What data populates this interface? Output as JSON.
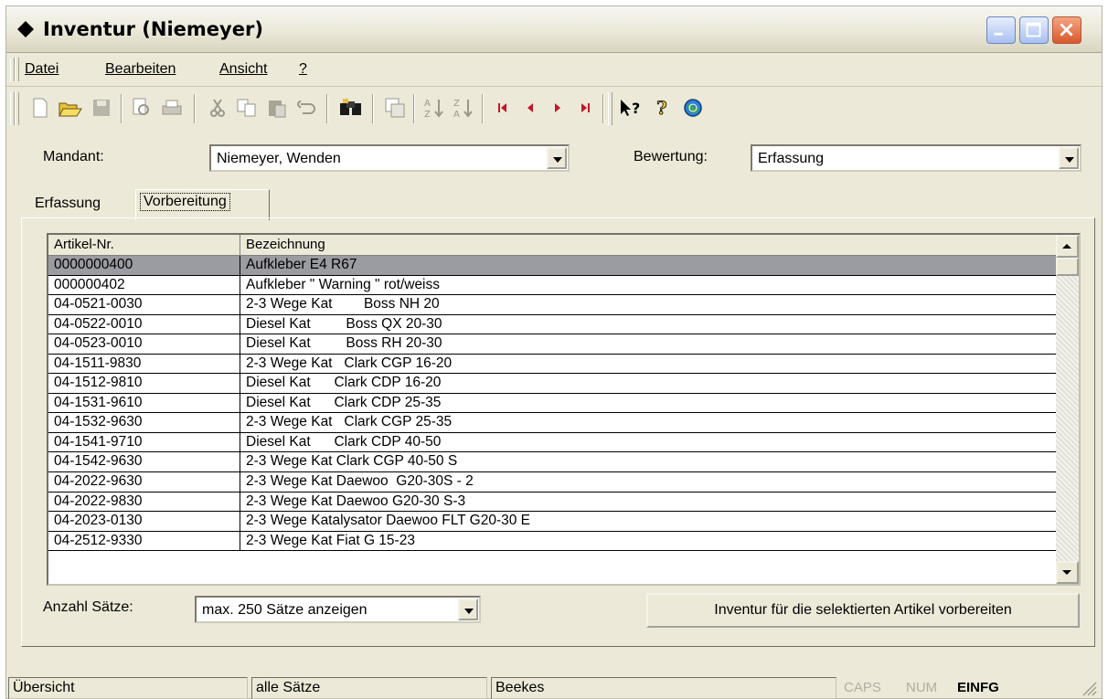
{
  "window": {
    "title": "Inventur (Niemeyer)"
  },
  "menu": [
    {
      "label": "Datei"
    },
    {
      "label": "Bearbeiten"
    },
    {
      "label": "Ansicht"
    },
    {
      "label": "?"
    }
  ],
  "toolbar": {
    "icons": [
      "new-icon",
      "open-icon",
      "save-icon",
      "print-preview-icon",
      "print-icon",
      "cut-icon",
      "copy-icon",
      "paste-icon",
      "undo-icon",
      "find-icon",
      "copy-record-icon",
      "sort-ascending-icon",
      "sort-descending-icon",
      "first-record-icon",
      "previous-record-icon",
      "next-record-icon",
      "last-record-icon",
      "whats-this-icon",
      "help-icon",
      "internet-icon"
    ]
  },
  "form": {
    "mandant_label": "Mandant:",
    "mandant_value": "Niemeyer, Wenden",
    "bewertung_label": "Bewertung:",
    "bewertung_value": "Erfassung"
  },
  "tabs": [
    {
      "label": "Erfassung",
      "active": false
    },
    {
      "label": "Vorbereitung",
      "active": true
    }
  ],
  "table": {
    "columns": [
      "Artikel-Nr.",
      "Bezeichnung"
    ],
    "rows": [
      [
        "0000000400",
        "Aufkleber E4 R67"
      ],
      [
        "000000402",
        "Aufkleber \" Warning \" rot/weiss"
      ],
      [
        "04-0521-0030",
        "2-3 Wege Kat        Boss NH 20"
      ],
      [
        "04-0522-0010",
        "Diesel Kat         Boss QX 20-30"
      ],
      [
        "04-0523-0010",
        "Diesel Kat         Boss RH 20-30"
      ],
      [
        "04-1511-9830",
        "2-3 Wege Kat   Clark CGP 16-20"
      ],
      [
        "04-1512-9810",
        "Diesel Kat      Clark CDP 16-20"
      ],
      [
        "04-1531-9610",
        "Diesel Kat      Clark CDP 25-35"
      ],
      [
        "04-1532-9630",
        "2-3 Wege Kat   Clark CGP 25-35"
      ],
      [
        "04-1541-9710",
        "Diesel Kat      Clark CDP 40-50"
      ],
      [
        "04-1542-9630",
        "2-3 Wege Kat Clark CGP 40-50 S"
      ],
      [
        "04-2022-9630",
        "2-3 Wege Kat Daewoo  G20-30S - 2"
      ],
      [
        "04-2022-9830",
        "2-3 Wege Kat Daewoo G20-30 S-3"
      ],
      [
        "04-2023-0130",
        "2-3 Wege Katalysator Daewoo FLT G20-30 E"
      ],
      [
        "04-2512-9330",
        "2-3 Wege Kat Fiat G 15-23"
      ]
    ],
    "selected_row": 0
  },
  "bottom": {
    "anzahl_label": "Anzahl Sätze:",
    "anzahl_value": "max. 250 Sätze anzeigen",
    "action_button": "Inventur für die selektierten Artikel vorbereiten"
  },
  "status": {
    "panel1": "Übersicht",
    "panel2": "alle Sätze",
    "panel3": "Beekes",
    "caps": "CAPS",
    "num": "NUM",
    "einfg": "EINFG"
  }
}
